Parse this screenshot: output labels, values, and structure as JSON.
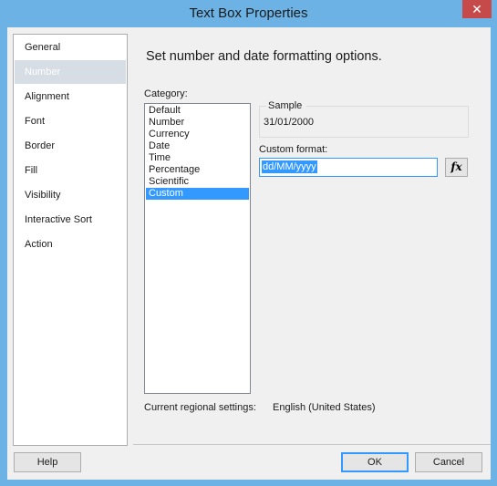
{
  "window": {
    "title": "Text Box Properties",
    "close_glyph": "✕"
  },
  "nav": {
    "items": [
      {
        "label": "General",
        "selected": false
      },
      {
        "label": "Number",
        "selected": true
      },
      {
        "label": "Alignment",
        "selected": false
      },
      {
        "label": "Font",
        "selected": false
      },
      {
        "label": "Border",
        "selected": false
      },
      {
        "label": "Fill",
        "selected": false
      },
      {
        "label": "Visibility",
        "selected": false
      },
      {
        "label": "Interactive Sort",
        "selected": false
      },
      {
        "label": "Action",
        "selected": false
      }
    ]
  },
  "main": {
    "heading": "Set number and date formatting options.",
    "category_label": "Category:",
    "categories": [
      {
        "label": "Default",
        "selected": false
      },
      {
        "label": "Number",
        "selected": false
      },
      {
        "label": "Currency",
        "selected": false
      },
      {
        "label": "Date",
        "selected": false
      },
      {
        "label": "Time",
        "selected": false
      },
      {
        "label": "Percentage",
        "selected": false
      },
      {
        "label": "Scientific",
        "selected": false
      },
      {
        "label": "Custom",
        "selected": true
      }
    ],
    "sample_label": "Sample",
    "sample_value": "31/01/2000",
    "custom_format_label": "Custom format:",
    "custom_format_value": "dd/MM/yyyy",
    "fx_label": "fx",
    "regional_label": "Current regional settings:",
    "regional_value": "English (United States)"
  },
  "footer": {
    "help": "Help",
    "ok": "OK",
    "cancel": "Cancel"
  },
  "colors": {
    "accent": "#3399ff",
    "titlebar": "#6cb2e5",
    "close": "#c74a4a",
    "nav_selected": "#d6dde5"
  }
}
